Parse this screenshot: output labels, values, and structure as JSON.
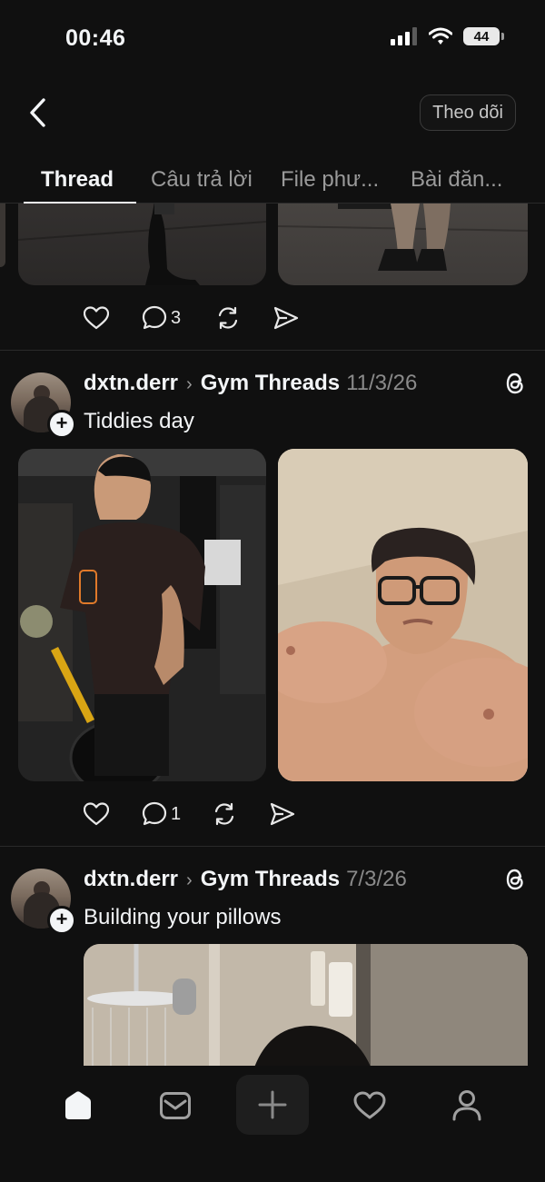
{
  "status_bar": {
    "time": "00:46",
    "battery": "44"
  },
  "header": {
    "follow_label": "Theo dõi"
  },
  "tabs": [
    {
      "label": "Thread",
      "active": true
    },
    {
      "label": "Câu trả lời"
    },
    {
      "label": "File phư..."
    },
    {
      "label": "Bài đăn..."
    }
  ],
  "feed": {
    "partial_post": {
      "replies": "3"
    },
    "posts": [
      {
        "username": "dxtn.derr",
        "topic": "Gym Threads",
        "date": "11/3/26",
        "text": "Tiddies day",
        "replies": "1"
      },
      {
        "username": "dxtn.derr",
        "topic": "Gym Threads",
        "date": "7/3/26",
        "text": "Building your pillows"
      }
    ]
  },
  "colors": {
    "background": "#101010",
    "text": "#f3f5f7",
    "muted": "#9a9a9a",
    "divider": "#2a2a2a"
  },
  "icons": [
    "back-arrow-icon",
    "heart-icon",
    "comment-icon",
    "repost-icon",
    "share-icon",
    "threads-logo-icon",
    "home-icon",
    "inbox-icon",
    "create-plus-icon",
    "activity-heart-icon",
    "profile-icon"
  ]
}
